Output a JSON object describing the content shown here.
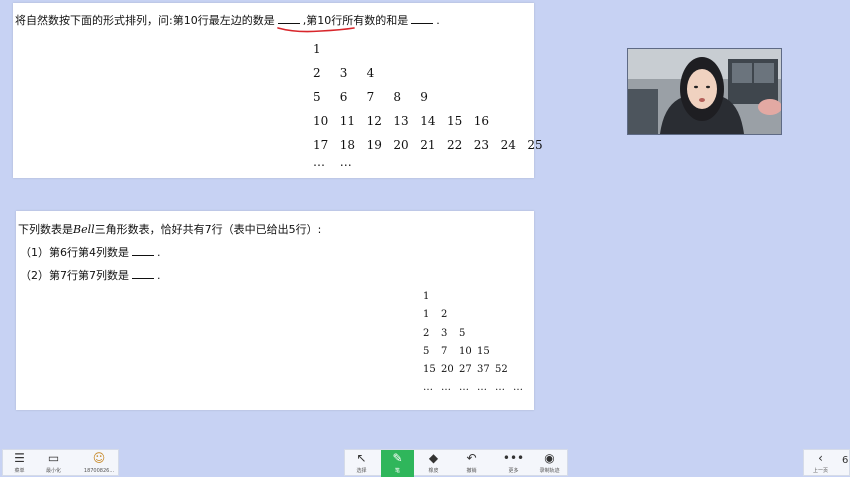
{
  "q1": {
    "prefix": "将自然数按下面的形式排列，问:第10行最左边的数是",
    "mid": ",第10行所有数的和是",
    "suffix": ".",
    "rows": [
      [
        "1"
      ],
      [
        "2",
        "3",
        "4"
      ],
      [
        "5",
        "6",
        "7",
        "8",
        "9"
      ],
      [
        "10",
        "11",
        "12",
        "13",
        "14",
        "15",
        "16"
      ],
      [
        "17",
        "18",
        "19",
        "20",
        "21",
        "22",
        "23",
        "24",
        "25"
      ],
      [
        "…",
        "…"
      ]
    ]
  },
  "q2": {
    "intro_a": "下列数表是",
    "intro_bell": "Bell",
    "intro_b": "三角形数表，恰好共有7行（表中已给出5行）:",
    "sub1_prefix": "（1）第6行第4列数是",
    "sub1_suffix": ".",
    "sub2_prefix": "（2）第7行第7列数是",
    "sub2_suffix": ".",
    "rows": [
      [
        "1"
      ],
      [
        "1",
        "2"
      ],
      [
        "2",
        "3",
        "5"
      ],
      [
        "5",
        "7",
        "10",
        "15"
      ],
      [
        "15",
        "20",
        "27",
        "37",
        "52"
      ],
      [
        "…",
        "…",
        "…",
        "…",
        "…",
        "…"
      ]
    ]
  },
  "toolbar": {
    "left": [
      {
        "icon": "menu-icon",
        "label": "菜单"
      },
      {
        "icon": "minimize-icon",
        "label": "最小化"
      },
      {
        "icon": "avatar-icon",
        "label": "18700826..."
      }
    ],
    "center": [
      {
        "icon": "cursor-icon",
        "label": "选择"
      },
      {
        "icon": "pen-icon",
        "label": "笔"
      },
      {
        "icon": "eraser-icon",
        "label": "橡皮"
      },
      {
        "icon": "undo-icon",
        "label": "撤销"
      },
      {
        "icon": "more-icon",
        "label": "更多"
      },
      {
        "icon": "record-icon",
        "label": "录制轨迹"
      }
    ],
    "right": [
      {
        "icon": "prev-page-icon",
        "label": "上一页"
      }
    ],
    "page_number": "6"
  },
  "colors": {
    "background": "#c7d2f3",
    "pen_active": "#2fb65b",
    "annotation": "#d8262b"
  }
}
